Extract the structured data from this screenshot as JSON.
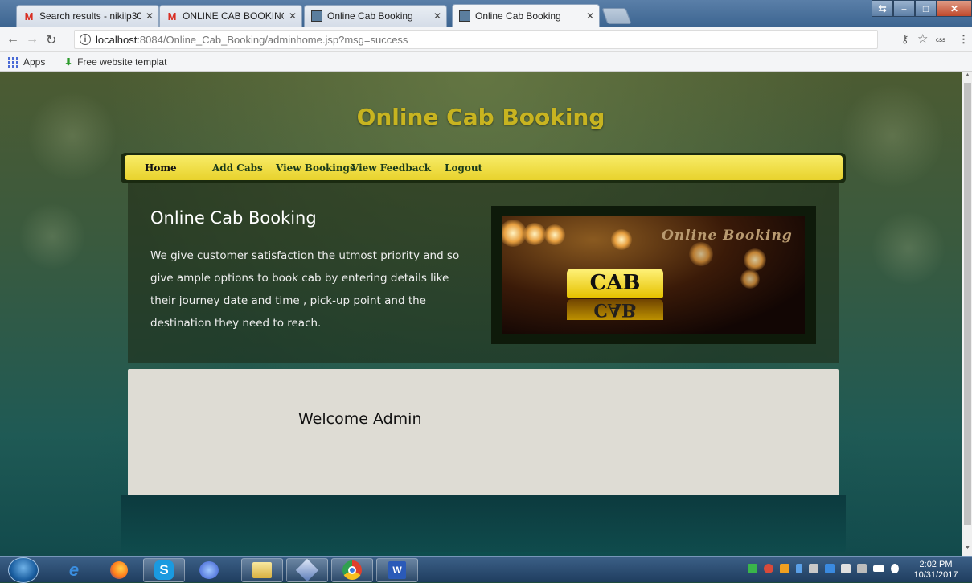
{
  "browser": {
    "tabs": [
      {
        "title": "Search results - nikilp30(",
        "icon": "gmail-icon",
        "active": false
      },
      {
        "title": "ONLINE CAB BOOKING -",
        "icon": "gmail-icon",
        "active": false
      },
      {
        "title": "Online Cab Booking",
        "icon": "page-favicon",
        "active": false
      },
      {
        "title": "Online Cab Booking",
        "icon": "page-favicon",
        "active": true
      }
    ],
    "url_host": "localhost",
    "url_path": ":8084/Online_Cab_Booking/adminhome.jsp?msg=success",
    "bookmarks": [
      {
        "label": "Apps",
        "icon": "apps-grid-icon"
      },
      {
        "label": "Free website templat",
        "icon": "download-arrow-icon"
      }
    ],
    "extension_label": "css"
  },
  "page": {
    "site_title": "Online Cab Booking",
    "nav": [
      "Home",
      "Add Cabs",
      "View Bookings",
      "View Feedback",
      "Logout"
    ],
    "hero_heading": "Online Cab Booking",
    "hero_text": "We give customer satisfaction the utmost priority and so give ample options to book cab by entering details like their journey date and time , pick-up point and the destination they need to reach.",
    "hero_image": {
      "sign_text": "CAB",
      "script_text": "Online Booking"
    },
    "welcome_text": "Welcome Admin"
  },
  "taskbar": {
    "apps": [
      "internet-explorer-icon",
      "firefox-icon",
      "skype-icon",
      "media-player-icon",
      "file-explorer-icon",
      "virtualbox-icon",
      "chrome-icon",
      "word-icon"
    ],
    "time": "2:02 PM",
    "date": "10/31/2017"
  },
  "colors": {
    "site_title": "#c8b420",
    "menubar": "#f0dc44",
    "content_box": "#dedcd4"
  }
}
